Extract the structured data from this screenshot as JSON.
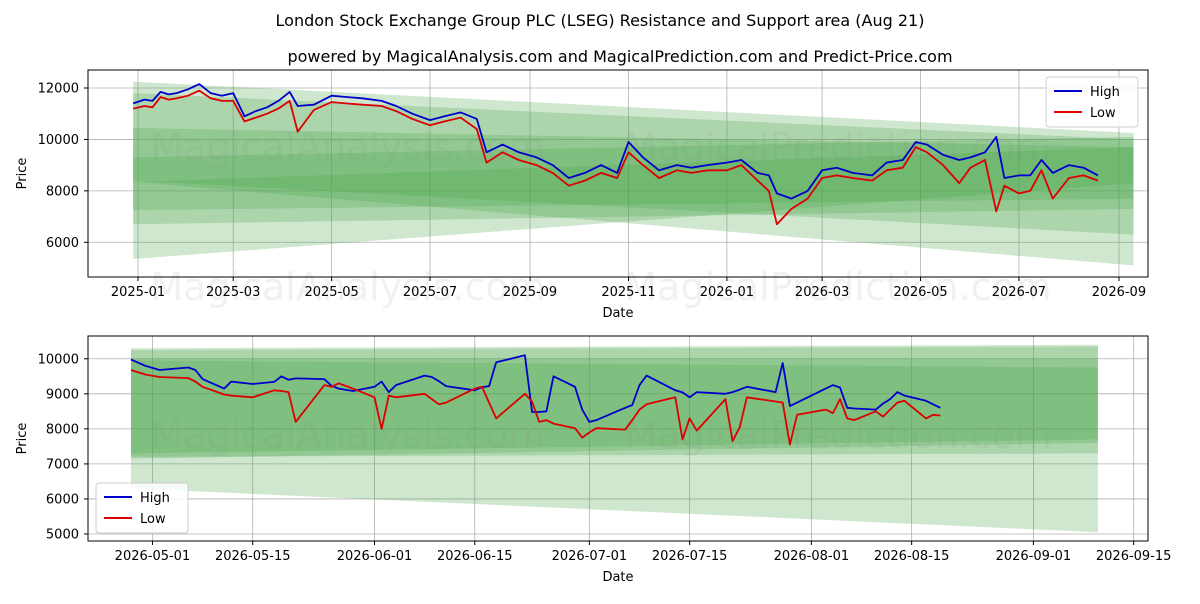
{
  "title": "London Stock Exchange Group PLC (LSEG) Resistance and Support area (Aug 21)",
  "subtitle": "powered by MagicalAnalysis.com and MagicalPrediction.com and Predict-Price.com",
  "watermarks": [
    "MagicalAnalysis.com",
    "MagicalPrediction.com"
  ],
  "colors": {
    "high": "#0000cc",
    "low": "#dd0000",
    "band": "#4ca64c",
    "grid": "#b0b0b0"
  },
  "chart_data": [
    {
      "type": "line",
      "xlabel": "Date",
      "ylabel": "Price",
      "xlim": [
        "2024-12-01",
        "2026-09-19"
      ],
      "ylim": [
        4650,
        12700
      ],
      "x_ticks": [
        "2025-01",
        "2025-03",
        "2025-05",
        "2025-07",
        "2025-09",
        "2025-11",
        "2026-01",
        "2026-03",
        "2026-05",
        "2026-07",
        "2026-09"
      ],
      "y_ticks": [
        6000,
        8000,
        10000,
        12000
      ],
      "grid": true,
      "legend": "top-right",
      "bands": [
        {
          "x": [
            "2024-12-29",
            "2026-09-10"
          ],
          "upper": [
            12250,
            10250
          ],
          "lower": [
            8350,
            5100
          ]
        },
        {
          "x": [
            "2024-12-29",
            "2026-09-10"
          ],
          "upper": [
            11800,
            10000
          ],
          "lower": [
            8400,
            6300
          ]
        },
        {
          "x": [
            "2024-12-29",
            "2026-09-10"
          ],
          "upper": [
            10450,
            9700
          ],
          "lower": [
            5350,
            8300
          ]
        },
        {
          "x": [
            "2024-12-29",
            "2026-09-10"
          ],
          "upper": [
            9300,
            10100
          ],
          "lower": [
            6700,
            7300
          ]
        },
        {
          "x": [
            "2024-12-29",
            "2026-09-10"
          ],
          "upper": [
            8350,
            9700
          ],
          "lower": [
            7250,
            7700
          ]
        }
      ],
      "series": [
        {
          "name": "High",
          "x": [
            "2024-12-29",
            "2025-01-05",
            "2025-01-10",
            "2025-01-15",
            "2025-01-20",
            "2025-01-25",
            "2025-02-01",
            "2025-02-08",
            "2025-02-15",
            "2025-02-22",
            "2025-03-01",
            "2025-03-08",
            "2025-03-15",
            "2025-03-22",
            "2025-03-29",
            "2025-04-05",
            "2025-04-10",
            "2025-04-20",
            "2025-05-01",
            "2025-05-10",
            "2025-05-20",
            "2025-06-01",
            "2025-06-10",
            "2025-06-20",
            "2025-07-01",
            "2025-07-10",
            "2025-07-20",
            "2025-07-30",
            "2025-08-05",
            "2025-08-15",
            "2025-08-25",
            "2025-09-05",
            "2025-09-15",
            "2025-09-25",
            "2025-10-05",
            "2025-10-15",
            "2025-10-25",
            "2025-11-01",
            "2025-11-10",
            "2025-11-20",
            "2025-12-01",
            "2025-12-10",
            "2025-12-20",
            "2026-01-01",
            "2026-01-10",
            "2026-01-20",
            "2026-01-27",
            "2026-02-01",
            "2026-02-10",
            "2026-02-20",
            "2026-03-01",
            "2026-03-10",
            "2026-03-20",
            "2026-04-01",
            "2026-04-10",
            "2026-04-20",
            "2026-04-28",
            "2026-05-05",
            "2026-05-15",
            "2026-05-25",
            "2026-06-01",
            "2026-06-10",
            "2026-06-17",
            "2026-06-22",
            "2026-07-01",
            "2026-07-08",
            "2026-07-15",
            "2026-07-22",
            "2026-08-01",
            "2026-08-10",
            "2026-08-19"
          ],
          "y": [
            11400,
            11550,
            11500,
            11850,
            11750,
            11800,
            11950,
            12150,
            11800,
            11700,
            11800,
            10900,
            11100,
            11250,
            11500,
            11850,
            11300,
            11350,
            11700,
            11650,
            11600,
            11500,
            11300,
            11000,
            10750,
            10900,
            11050,
            10800,
            9500,
            9800,
            9500,
            9300,
            9000,
            8500,
            8700,
            9000,
            8700,
            9900,
            9300,
            8800,
            9000,
            8900,
            9000,
            9100,
            9200,
            8700,
            8600,
            7900,
            7700,
            8000,
            8800,
            8900,
            8700,
            8600,
            9100,
            9200,
            9900,
            9800,
            9400,
            9200,
            9300,
            9500,
            10100,
            8500,
            8600,
            8600,
            9200,
            8700,
            9000,
            8900,
            8600
          ]
        },
        {
          "name": "Low",
          "x": [
            "2024-12-29",
            "2025-01-05",
            "2025-01-10",
            "2025-01-15",
            "2025-01-20",
            "2025-01-25",
            "2025-02-01",
            "2025-02-08",
            "2025-02-15",
            "2025-02-22",
            "2025-03-01",
            "2025-03-08",
            "2025-03-15",
            "2025-03-22",
            "2025-03-29",
            "2025-04-05",
            "2025-04-10",
            "2025-04-20",
            "2025-05-01",
            "2025-05-10",
            "2025-05-20",
            "2025-06-01",
            "2025-06-10",
            "2025-06-20",
            "2025-07-01",
            "2025-07-10",
            "2025-07-20",
            "2025-07-30",
            "2025-08-05",
            "2025-08-15",
            "2025-08-25",
            "2025-09-05",
            "2025-09-15",
            "2025-09-25",
            "2025-10-05",
            "2025-10-15",
            "2025-10-25",
            "2025-11-01",
            "2025-11-10",
            "2025-11-20",
            "2025-12-01",
            "2025-12-10",
            "2025-12-20",
            "2026-01-01",
            "2026-01-10",
            "2026-01-20",
            "2026-01-27",
            "2026-02-01",
            "2026-02-10",
            "2026-02-20",
            "2026-03-01",
            "2026-03-10",
            "2026-03-20",
            "2026-04-01",
            "2026-04-10",
            "2026-04-20",
            "2026-04-28",
            "2026-05-05",
            "2026-05-15",
            "2026-05-25",
            "2026-06-01",
            "2026-06-10",
            "2026-06-17",
            "2026-06-22",
            "2026-07-01",
            "2026-07-08",
            "2026-07-15",
            "2026-07-22",
            "2026-08-01",
            "2026-08-10",
            "2026-08-19"
          ],
          "y": [
            11200,
            11300,
            11250,
            11650,
            11550,
            11600,
            11700,
            11900,
            11600,
            11500,
            11500,
            10700,
            10850,
            11000,
            11200,
            11500,
            10300,
            11150,
            11450,
            11400,
            11350,
            11300,
            11100,
            10800,
            10550,
            10700,
            10850,
            10400,
            9100,
            9500,
            9200,
            9000,
            8700,
            8200,
            8400,
            8700,
            8500,
            9500,
            9000,
            8500,
            8800,
            8700,
            8800,
            8800,
            9000,
            8400,
            8000,
            6700,
            7300,
            7700,
            8500,
            8600,
            8500,
            8400,
            8800,
            8900,
            9700,
            9500,
            9000,
            8300,
            8900,
            9200,
            7200,
            8200,
            7900,
            8000,
            8800,
            7700,
            8500,
            8600,
            8400
          ]
        }
      ]
    },
    {
      "type": "line",
      "xlabel": "Date",
      "ylabel": "Price",
      "xlim": [
        "2026-04-22",
        "2026-09-17"
      ],
      "ylim": [
        4800,
        10650
      ],
      "x_ticks": [
        "2026-05-01",
        "2026-05-15",
        "2026-06-01",
        "2026-06-15",
        "2026-07-01",
        "2026-07-15",
        "2026-08-01",
        "2026-08-15",
        "2026-09-01",
        "2026-09-15"
      ],
      "y_ticks": [
        5000,
        6000,
        7000,
        8000,
        9000,
        10000
      ],
      "grid": true,
      "legend": "bottom-left",
      "bands": [
        {
          "x": [
            "2026-04-28",
            "2026-09-10"
          ],
          "upper": [
            10300,
            10400
          ],
          "lower": [
            6300,
            5050
          ]
        },
        {
          "x": [
            "2026-04-28",
            "2026-09-10"
          ],
          "upper": [
            10250,
            10350
          ],
          "lower": [
            7200,
            7300
          ]
        },
        {
          "x": [
            "2026-04-28",
            "2026-09-10"
          ],
          "upper": [
            10000,
            10000
          ],
          "lower": [
            7150,
            7600
          ]
        },
        {
          "x": [
            "2026-04-28",
            "2026-09-10"
          ],
          "upper": [
            9950,
            9750
          ],
          "lower": [
            7300,
            7700
          ]
        }
      ],
      "series": [
        {
          "name": "High",
          "x": [
            "2026-04-28",
            "2026-04-30",
            "2026-05-02",
            "2026-05-06",
            "2026-05-07",
            "2026-05-08",
            "2026-05-11",
            "2026-05-12",
            "2026-05-15",
            "2026-05-18",
            "2026-05-19",
            "2026-05-20",
            "2026-05-21",
            "2026-05-25",
            "2026-05-26",
            "2026-05-27",
            "2026-05-29",
            "2026-06-01",
            "2026-06-02",
            "2026-06-03",
            "2026-06-04",
            "2026-06-08",
            "2026-06-09",
            "2026-06-10",
            "2026-06-11",
            "2026-06-15",
            "2026-06-16",
            "2026-06-17",
            "2026-06-18",
            "2026-06-22",
            "2026-06-23",
            "2026-06-24",
            "2026-06-25",
            "2026-06-26",
            "2026-06-29",
            "2026-06-30",
            "2026-07-01",
            "2026-07-02",
            "2026-07-06",
            "2026-07-07",
            "2026-07-08",
            "2026-07-09",
            "2026-07-13",
            "2026-07-14",
            "2026-07-15",
            "2026-07-16",
            "2026-07-20",
            "2026-07-21",
            "2026-07-22",
            "2026-07-23",
            "2026-07-27",
            "2026-07-28",
            "2026-07-29",
            "2026-07-30",
            "2026-08-03",
            "2026-08-04",
            "2026-08-05",
            "2026-08-06",
            "2026-08-07",
            "2026-08-10",
            "2026-08-11",
            "2026-08-12",
            "2026-08-13",
            "2026-08-14",
            "2026-08-17",
            "2026-08-18",
            "2026-08-19"
          ],
          "y": [
            9980,
            9800,
            9680,
            9750,
            9680,
            9420,
            9150,
            9350,
            9280,
            9340,
            9500,
            9400,
            9440,
            9420,
            9230,
            9150,
            9080,
            9200,
            9350,
            9050,
            9250,
            9520,
            9480,
            9360,
            9220,
            9100,
            9190,
            9220,
            9900,
            10100,
            8480,
            8480,
            8500,
            9500,
            9200,
            8550,
            8200,
            8250,
            8600,
            8680,
            9250,
            9520,
            9100,
            9040,
            8900,
            9050,
            9000,
            9050,
            9120,
            9200,
            9050,
            9880,
            8650,
            8750,
            9150,
            9250,
            9180,
            8600,
            8580,
            8550,
            8720,
            8850,
            9050,
            8950,
            8800,
            8700,
            8600
          ]
        },
        {
          "name": "Low",
          "x": [
            "2026-04-28",
            "2026-04-30",
            "2026-05-02",
            "2026-05-06",
            "2026-05-07",
            "2026-05-08",
            "2026-05-11",
            "2026-05-12",
            "2026-05-15",
            "2026-05-18",
            "2026-05-19",
            "2026-05-20",
            "2026-05-21",
            "2026-05-25",
            "2026-05-26",
            "2026-05-27",
            "2026-05-29",
            "2026-06-01",
            "2026-06-02",
            "2026-06-03",
            "2026-06-04",
            "2026-06-08",
            "2026-06-09",
            "2026-06-10",
            "2026-06-11",
            "2026-06-15",
            "2026-06-16",
            "2026-06-17",
            "2026-06-18",
            "2026-06-22",
            "2026-06-23",
            "2026-06-24",
            "2026-06-25",
            "2026-06-26",
            "2026-06-29",
            "2026-06-30",
            "2026-07-01",
            "2026-07-02",
            "2026-07-06",
            "2026-07-07",
            "2026-07-08",
            "2026-07-09",
            "2026-07-13",
            "2026-07-14",
            "2026-07-15",
            "2026-07-16",
            "2026-07-20",
            "2026-07-21",
            "2026-07-22",
            "2026-07-23",
            "2026-07-27",
            "2026-07-28",
            "2026-07-29",
            "2026-07-30",
            "2026-08-03",
            "2026-08-04",
            "2026-08-05",
            "2026-08-06",
            "2026-08-07",
            "2026-08-10",
            "2026-08-11",
            "2026-08-12",
            "2026-08-13",
            "2026-08-14",
            "2026-08-17",
            "2026-08-18",
            "2026-08-19"
          ],
          "y": [
            9680,
            9550,
            9480,
            9450,
            9350,
            9200,
            8980,
            8950,
            8900,
            9100,
            9080,
            9050,
            8200,
            9250,
            9200,
            9300,
            9150,
            8900,
            8000,
            8950,
            8900,
            9000,
            8850,
            8700,
            8750,
            9150,
            9200,
            8750,
            8300,
            9000,
            8780,
            8200,
            8250,
            8150,
            8020,
            7750,
            7900,
            8020,
            7980,
            8250,
            8550,
            8700,
            8900,
            7700,
            8300,
            7950,
            8850,
            7650,
            8050,
            8900,
            8780,
            8750,
            7550,
            8400,
            8550,
            8450,
            8850,
            8300,
            8250,
            8500,
            8350,
            8550,
            8750,
            8800,
            8300,
            8400,
            8380
          ]
        }
      ]
    }
  ]
}
